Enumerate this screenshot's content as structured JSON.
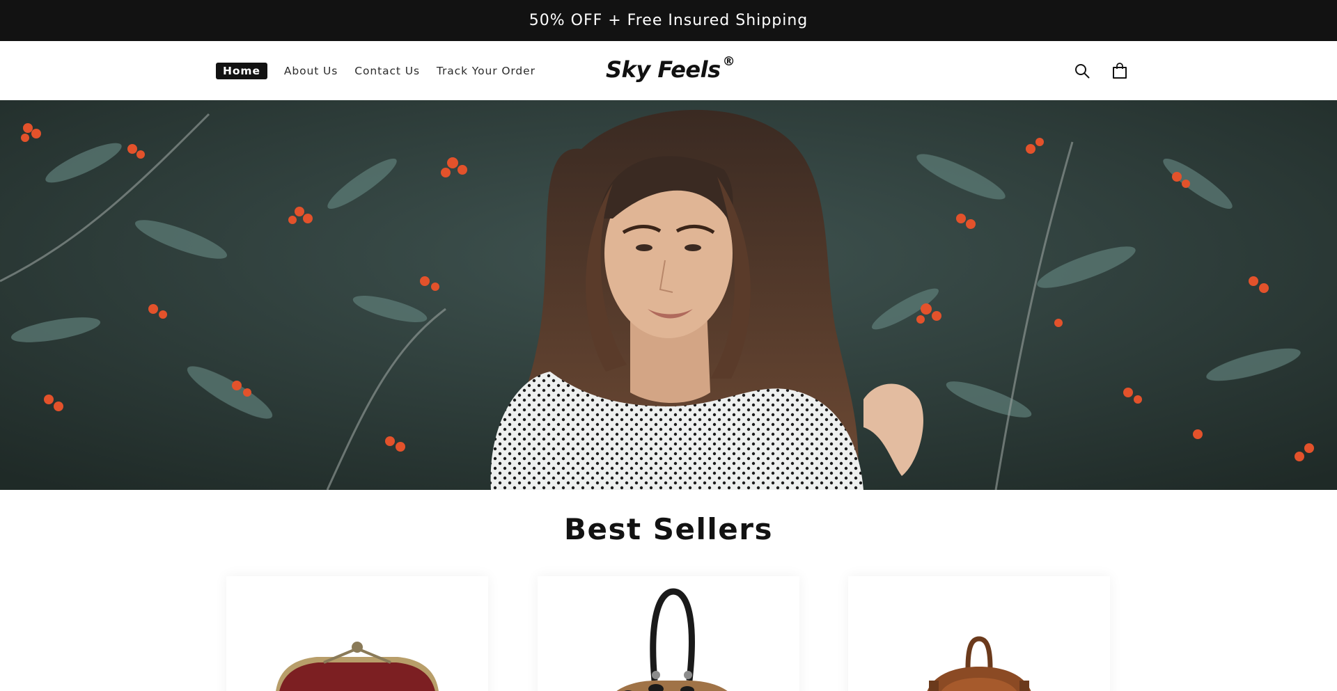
{
  "announcement": {
    "text": "50% OFF + Free Insured Shipping"
  },
  "header": {
    "nav": [
      {
        "label": "Home",
        "active": true
      },
      {
        "label": "About Us",
        "active": false
      },
      {
        "label": "Contact Us",
        "active": false
      },
      {
        "label": "Track Your Order",
        "active": false
      }
    ],
    "logo": {
      "text": "Sky Feels",
      "mark": "®"
    },
    "icons": [
      "search-icon",
      "cart-icon"
    ]
  },
  "hero": {
    "image": "woman-curly-hair-in-front-of-rowan-berry-bush"
  },
  "best_sellers": {
    "title": "Best Sellers",
    "products": [
      {
        "image": "red-leather-clasp-purse"
      },
      {
        "image": "leopard-print-handbag"
      },
      {
        "image": "brown-leather-backpack"
      }
    ]
  },
  "colors": {
    "announcement_bg": "#121212",
    "text": "#121212",
    "background": "#ffffff"
  }
}
